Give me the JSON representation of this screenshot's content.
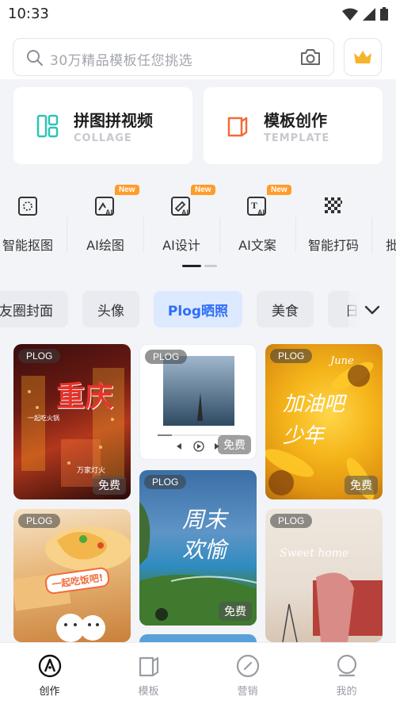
{
  "status": {
    "time": "10:33"
  },
  "search": {
    "placeholder": "30万精品模板任您挑选"
  },
  "cards": [
    {
      "title": "拼图拼视频",
      "subtitle": "COLLAGE"
    },
    {
      "title": "模板创作",
      "subtitle": "TEMPLATE"
    }
  ],
  "tools": [
    {
      "label": "智能抠图",
      "badge": ""
    },
    {
      "label": "AI绘图",
      "badge": "New"
    },
    {
      "label": "AI设计",
      "badge": "New"
    },
    {
      "label": "AI文案",
      "badge": "New"
    },
    {
      "label": "智能打码",
      "badge": ""
    },
    {
      "label": "批"
    }
  ],
  "categories": [
    "友圈封面",
    "头像",
    "Plog晒照",
    "美食",
    "日"
  ],
  "active_category": "Plog晒照",
  "templates": [
    {
      "tag": "PLOG",
      "price": "免费",
      "title": "重庆",
      "lines": [
        "一起吃火锅",
        "万家灯火"
      ]
    },
    {
      "tag": "PLOG",
      "price": "免费"
    },
    {
      "tag": "PLOG",
      "price": "免费",
      "title": "加油吧 少年",
      "script": "June"
    },
    {
      "tag": "PLOG",
      "title": "一起吃饭吧!"
    },
    {
      "tag": "PLOG",
      "price": "免费",
      "title": "周末 欢愉"
    },
    {
      "tag": "PLOG",
      "script": "Sweet home"
    }
  ],
  "nav": [
    {
      "label": "创作",
      "active": true
    },
    {
      "label": "模板"
    },
    {
      "label": "营销"
    },
    {
      "label": "我的"
    }
  ],
  "colors": {
    "accent": "#2d6ef5",
    "badge": "#ff9c2a",
    "collage_icon": "#2ec4b6",
    "template_icon": "#f26b3a"
  }
}
